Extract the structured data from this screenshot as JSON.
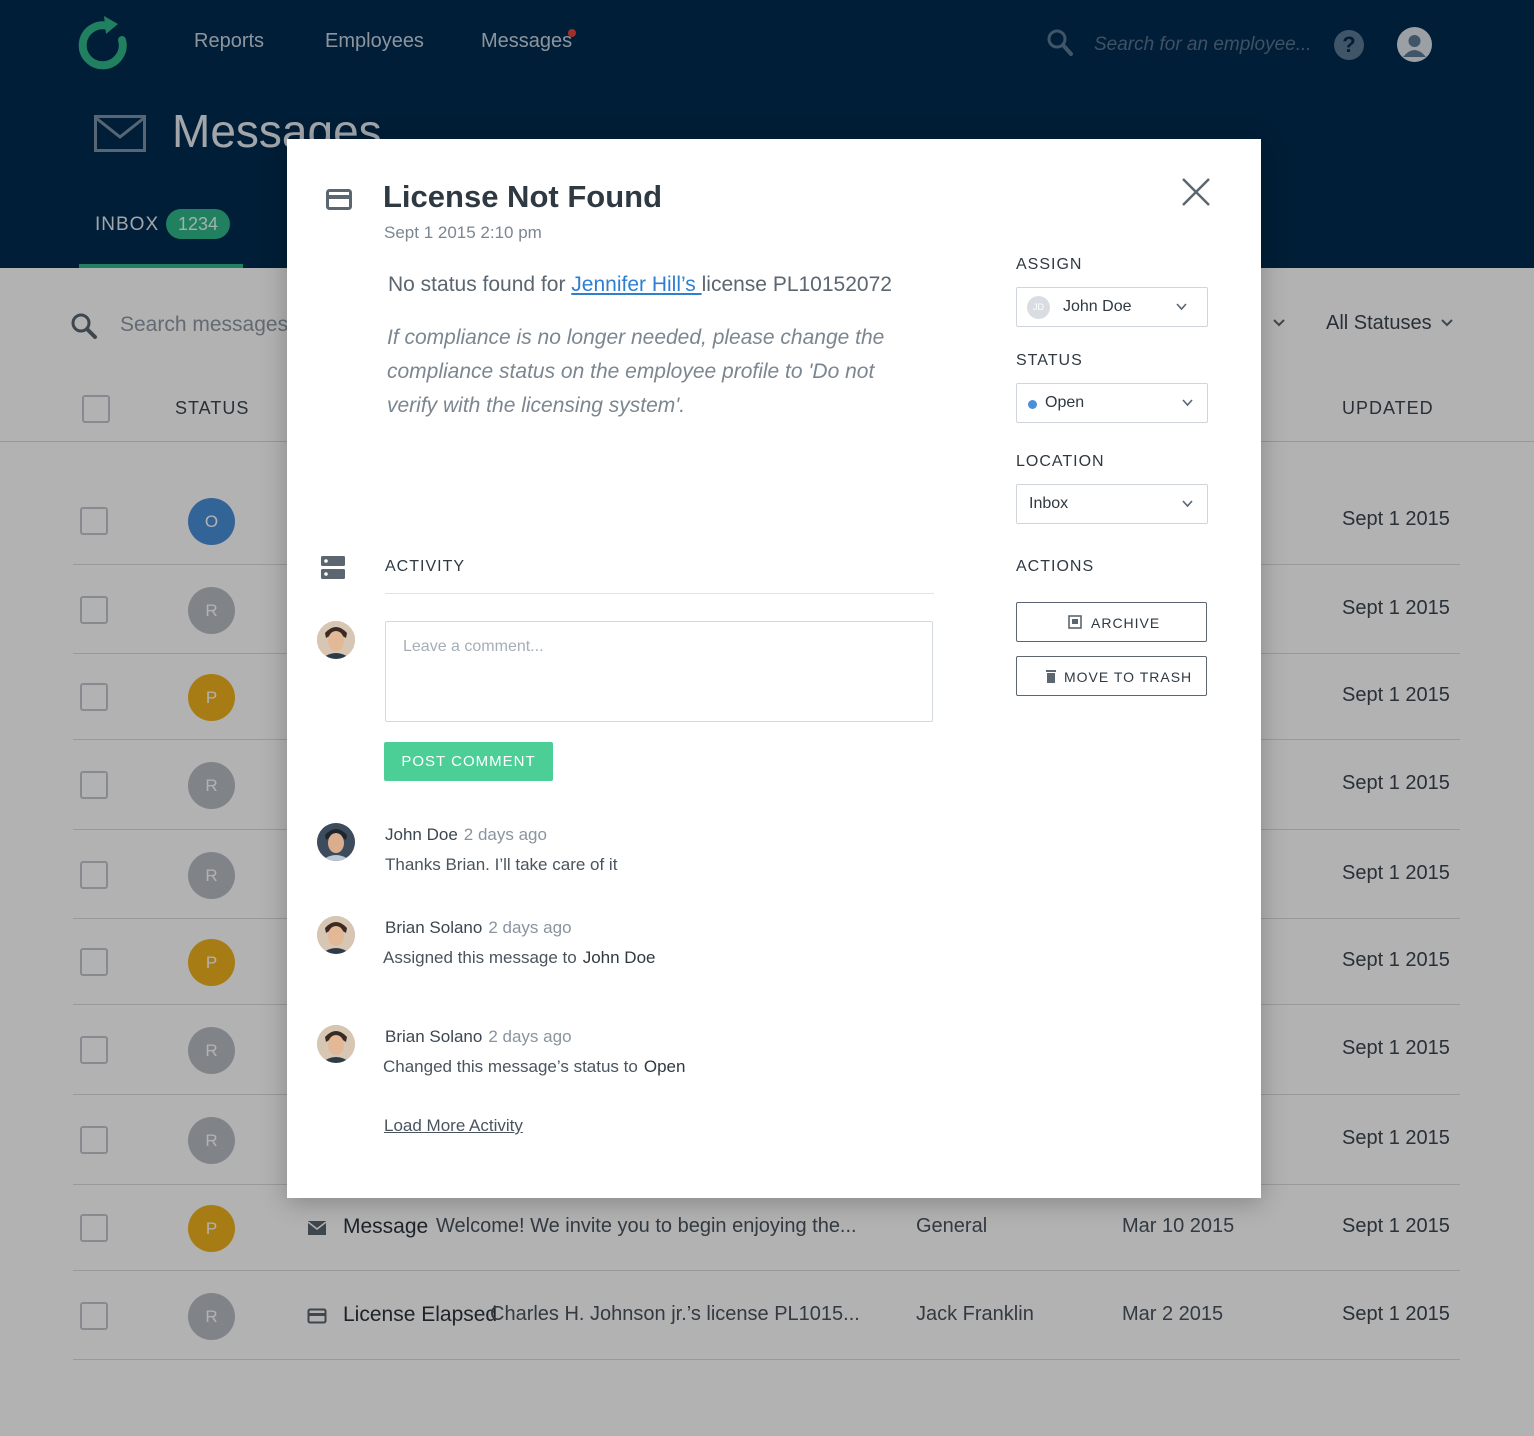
{
  "nav": {
    "items": [
      "Reports",
      "Employees",
      "Messages"
    ],
    "search_placeholder": "Search for an employee..."
  },
  "page": {
    "title": "Messages",
    "tab_label": "INBOX",
    "tab_count": "1234"
  },
  "list": {
    "search_placeholder": "Search messages...",
    "status_filter": "All Statuses",
    "columns": {
      "status": "STATUS",
      "updated": "UPDATED"
    },
    "rows": [
      {
        "initial": "O",
        "color": "#4a90d9",
        "updated": "Sept 1 2015"
      },
      {
        "initial": "R",
        "color": "#b8bec4",
        "updated": "Sept 1 2015"
      },
      {
        "initial": "P",
        "color": "#f0b21e",
        "updated": "Sept 1 2015"
      },
      {
        "initial": "R",
        "color": "#b8bec4",
        "updated": "Sept 1 2015"
      },
      {
        "initial": "R",
        "color": "#b8bec4",
        "updated": "Sept 1 2015"
      },
      {
        "initial": "P",
        "color": "#f0b21e",
        "updated": "Sept 1 2015"
      },
      {
        "initial": "R",
        "color": "#b8bec4",
        "updated": "Sept 1 2015"
      },
      {
        "initial": "R",
        "color": "#b8bec4",
        "updated": "Sept 1 2015"
      },
      {
        "initial": "P",
        "color": "#f0b21e",
        "updated": "Sept 1 2015",
        "type": "Message",
        "icon": "mail-icon",
        "preview": "Welcome! We invite you to begin enjoying the...",
        "category": "General",
        "created": "Mar 10 2015"
      },
      {
        "initial": "R",
        "color": "#b8bec4",
        "updated": "Sept 1 2015",
        "type": "License Elapsed",
        "icon": "card-icon",
        "preview": "Charles H. Johnson jr.’s license PL1015...",
        "category": "Jack Franklin",
        "created": "Mar 2 2015"
      }
    ]
  },
  "modal": {
    "title": "License Not Found",
    "date": "Sept 1 2015 2:10 pm",
    "body_prefix": "No status found for ",
    "body_link": "Jennifer Hill’s ",
    "body_suffix": "license PL10152072",
    "note": "If compliance is no longer needed, please change the compliance status on the employee profile to 'Do not verify with the licensing system'.",
    "activity_label": "ACTIVITY",
    "comment_placeholder": "Leave a comment...",
    "post_label": "POST COMMENT",
    "feed": [
      {
        "name": "John Doe",
        "time": "2 days ago",
        "text": "Thanks Brian. I’ll take care of it",
        "strong": ""
      },
      {
        "name": "Brian Solano",
        "time": "2 days ago",
        "text": "Assigned this message to",
        "strong": "John Doe"
      },
      {
        "name": "Brian Solano",
        "time": "2 days ago",
        "text": "Changed this message’s status to",
        "strong": "Open"
      }
    ],
    "load_more": "Load More Activity",
    "assign_label": "ASSIGN",
    "assign_value": "John Doe",
    "assign_initials": "JD",
    "status_label": "STATUS",
    "status_value": "Open",
    "location_label": "LOCATION",
    "location_value": "Inbox",
    "actions_label": "ACTIONS",
    "archive_label": "ARCHIVE",
    "trash_label": "MOVE TO TRASH"
  },
  "colors": {
    "header": "#002b4f",
    "accent_green": "#2fb88a",
    "post_button": "#4ccf96",
    "link": "#2f7fd1"
  }
}
